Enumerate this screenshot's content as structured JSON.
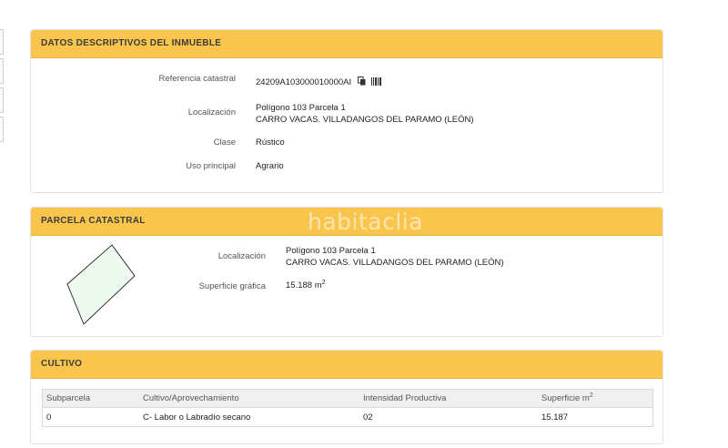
{
  "side_tabs": 4,
  "panel1": {
    "title": "DATOS DESCRIPTIVOS DEL INMUEBLE",
    "ref_label": "Referencia catastral",
    "ref_value": "24209A103000010000AI",
    "loc_label": "Localización",
    "loc_line1": "Polígono 103 Parcela 1",
    "loc_line2": "CARRO VACAS. VILLADANGOS DEL PARAMO (LEÓN)",
    "clase_label": "Clase",
    "clase_value": "Rústico",
    "uso_label": "Uso principal",
    "uso_value": "Agrario"
  },
  "panel2": {
    "title": "PARCELA CATASTRAL",
    "loc_label": "Localización",
    "loc_line1": "Polígono 103 Parcela 1",
    "loc_line2": "CARRO VACAS. VILLADANGOS DEL PARAMO (LEÓN)",
    "sup_label": "Superficie gráfica",
    "sup_value": "15.188 m",
    "sup_unit_exp": "2"
  },
  "watermark": "habitaclia",
  "panel3": {
    "title": "CULTIVO",
    "headers": [
      "Subparcela",
      "Cultivo/Aprovechamiento",
      "Intensidad Productiva",
      "Superficie m"
    ],
    "header_exp": "2",
    "rows": [
      [
        "0",
        "C- Labor o Labradío secano",
        "02",
        "15.187"
      ]
    ]
  },
  "icons": [
    "copy-icon",
    "barcode-icon"
  ],
  "colors": {
    "header_bg": "#f9c54d",
    "parcel_fill": "#eefaee"
  }
}
